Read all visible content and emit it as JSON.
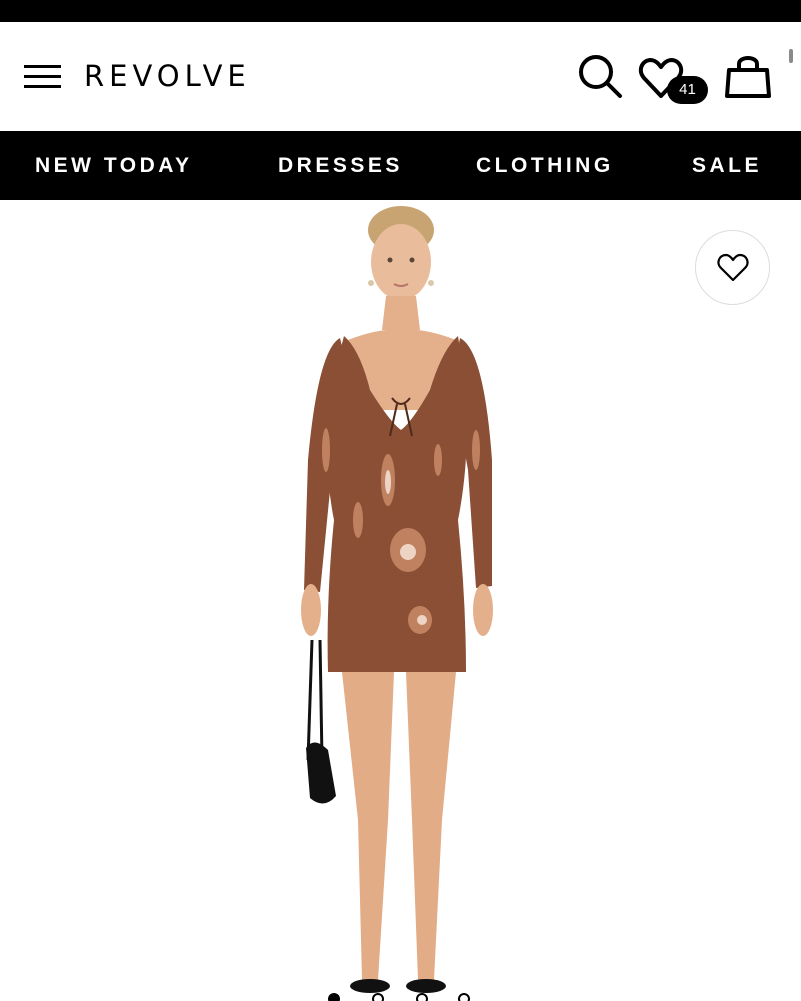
{
  "header": {
    "menu_icon": "hamburger-menu-icon",
    "logo": "REVOLVE",
    "search_icon": "search-icon",
    "wishlist_icon": "heart-icon",
    "wishlist_count": "41",
    "bag_icon": "shopping-bag-icon"
  },
  "nav": {
    "items": [
      {
        "label": "NEW TODAY"
      },
      {
        "label": "DRESSES"
      },
      {
        "label": "CLOTHING"
      },
      {
        "label": "SALE"
      }
    ]
  },
  "product": {
    "favorite_icon": "heart-outline-icon",
    "image": "model-in-brown-sequin-mini-dress",
    "dress_color": "#8a4f35",
    "gallery": {
      "total": 4,
      "active": 1
    }
  },
  "colors": {
    "accent": "#000000",
    "background": "#ffffff"
  }
}
